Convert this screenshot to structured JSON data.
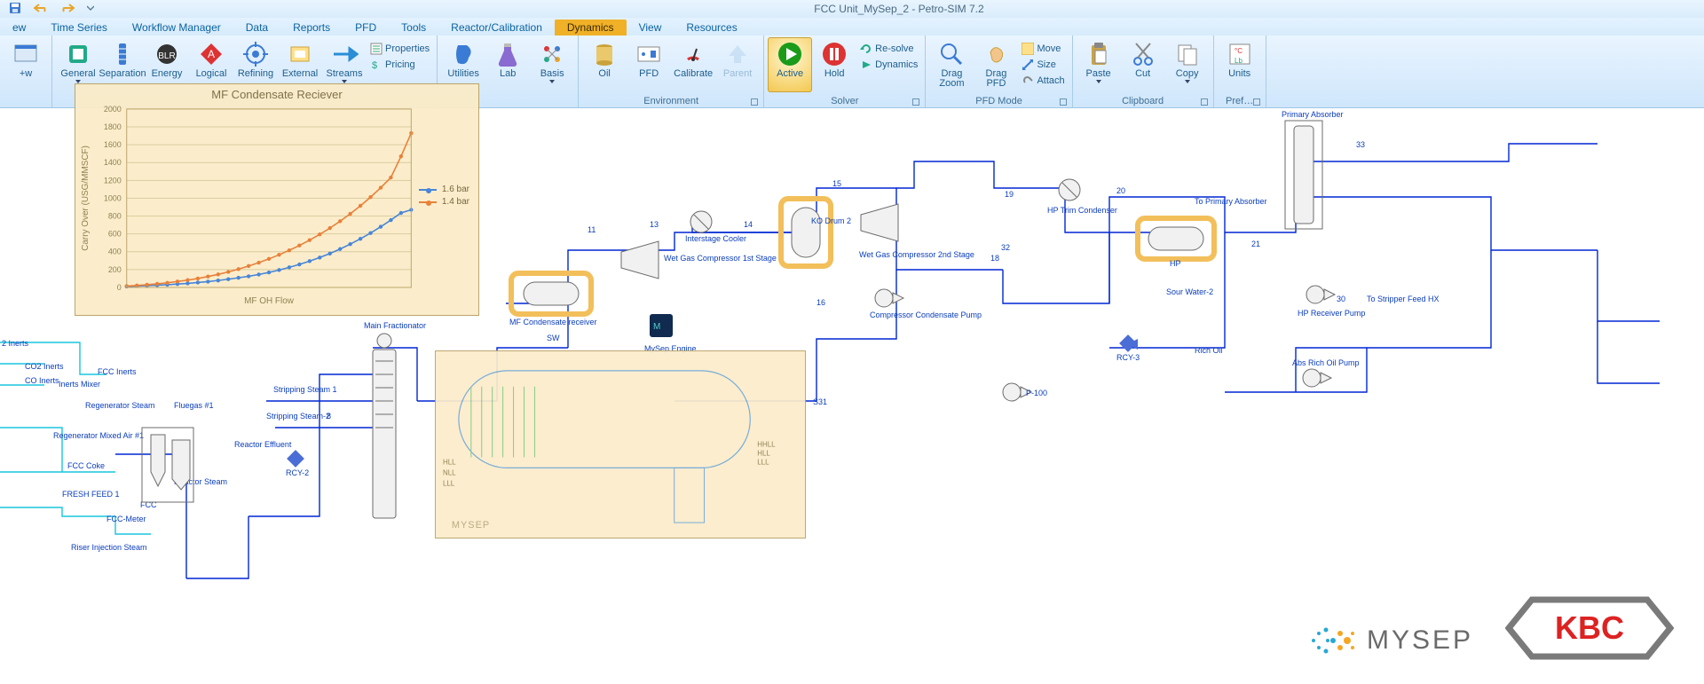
{
  "window": {
    "title": "FCC Unit_MySep_2 - Petro-SIM 7.2"
  },
  "menu": {
    "tabs": [
      "ew",
      "Time Series",
      "Workflow Manager",
      "Data",
      "Reports",
      "PFD",
      "Tools",
      "Reactor/Calibration",
      "Dynamics",
      "View",
      "Resources"
    ],
    "active_index": 8
  },
  "ribbon": {
    "groups": [
      {
        "label": "",
        "buttons": [
          {
            "t": "+w"
          }
        ]
      },
      {
        "label": "",
        "buttons": [
          {
            "t": "General",
            "drop": true
          },
          {
            "t": "Separation"
          },
          {
            "t": "Energy"
          },
          {
            "t": "Logical"
          },
          {
            "t": "Refining"
          },
          {
            "t": "External"
          },
          {
            "t": "Streams",
            "drop": true
          }
        ],
        "side": [
          {
            "t": "Properties"
          },
          {
            "t": "Pricing"
          }
        ]
      },
      {
        "label": "",
        "buttons": [
          {
            "t": "Utilities"
          },
          {
            "t": "Lab"
          },
          {
            "t": "Basis",
            "drop": true
          }
        ]
      },
      {
        "label": "Environment",
        "buttons": [
          {
            "t": "Oil"
          },
          {
            "t": "PFD"
          },
          {
            "t": "Calibrate"
          },
          {
            "t": "Parent",
            "faded": true
          }
        ]
      },
      {
        "label": "Solver",
        "buttons": [
          {
            "t": "Active",
            "lit": true
          },
          {
            "t": "Hold"
          }
        ],
        "side": [
          {
            "t": "Re-solve"
          },
          {
            "t": "Dynamics"
          }
        ]
      },
      {
        "label": "PFD Mode",
        "buttons": [
          {
            "t": "Drag\nZoom"
          },
          {
            "t": "Drag\nPFD"
          }
        ],
        "side": [
          {
            "t": "Move"
          },
          {
            "t": "Size"
          },
          {
            "t": "Attach"
          }
        ]
      },
      {
        "label": "Clipboard",
        "buttons": [
          {
            "t": "Paste",
            "drop": true
          },
          {
            "t": "Cut"
          },
          {
            "t": "Copy",
            "drop": true
          }
        ]
      },
      {
        "label": "Pref…",
        "buttons": [
          {
            "t": "Units"
          }
        ]
      }
    ]
  },
  "chart_data": {
    "type": "line",
    "title": "MF Condensate Reciever",
    "xlabel": "MF OH Flow",
    "ylabel": "Carry Over (USG/MMSCF)",
    "ylim": [
      0,
      2000
    ],
    "yticks": [
      0,
      200,
      400,
      600,
      800,
      1000,
      1200,
      1400,
      1600,
      1800,
      2000
    ],
    "series": [
      {
        "name": "1.6 bar",
        "color": "#3d7fd6",
        "values": [
          10,
          15,
          20,
          25,
          30,
          38,
          45,
          55,
          65,
          78,
          92,
          108,
          125,
          145,
          168,
          195,
          225,
          258,
          295,
          335,
          380,
          430,
          485,
          545,
          610,
          680,
          755,
          835,
          870
        ]
      },
      {
        "name": "1.4 bar",
        "color": "#e77a2f",
        "values": [
          15,
          22,
          30,
          40,
          52,
          66,
          82,
          100,
          122,
          146,
          174,
          205,
          240,
          278,
          320,
          366,
          416,
          470,
          530,
          595,
          665,
          742,
          825,
          915,
          1012,
          1118,
          1232,
          1470,
          1730
        ]
      }
    ]
  },
  "pfd": {
    "equipment_labels": [
      "Main Fractionator",
      "MF Condensate receiver",
      "Wet Gas Compressor 1st Stage",
      "Interstage Cooler",
      "KO Drum 2",
      "Wet Gas Compressor 2nd Stage",
      "Compressor Condensate Pump",
      "HP Trim Condenser",
      "HP",
      "To Primary Absorber",
      "Primary Absorber",
      "Sour Water-2",
      "HP Receiver Pump",
      "To Stripper Feed HX",
      "RCY-3",
      "Rich Oil",
      "Abs Rich Oil Pump",
      "P-100",
      "MySep Engine",
      "SW",
      "S31",
      "Stripping Steam 1",
      "Stripping Steam-2",
      "Reactor Effluent",
      "RCY-2",
      "Reactor Steam",
      "Regenerator Steam",
      "Fluegas #1",
      "Regenerator Mixed Air #1",
      "FCC Coke",
      "FRESH FEED 1",
      "FCC-Meter",
      "Riser Injection Steam",
      "FCC",
      "FCC Inerts",
      "Inerts Mixer",
      "CO2 Inerts",
      "CO Inerts",
      "2 Inerts",
      "8"
    ],
    "stream_tags": [
      "11",
      "13",
      "14",
      "15",
      "16",
      "18",
      "19",
      "20",
      "21",
      "30",
      "32",
      "33"
    ]
  },
  "logos": {
    "mysep": "MYSEP",
    "kbc": "KBC"
  }
}
